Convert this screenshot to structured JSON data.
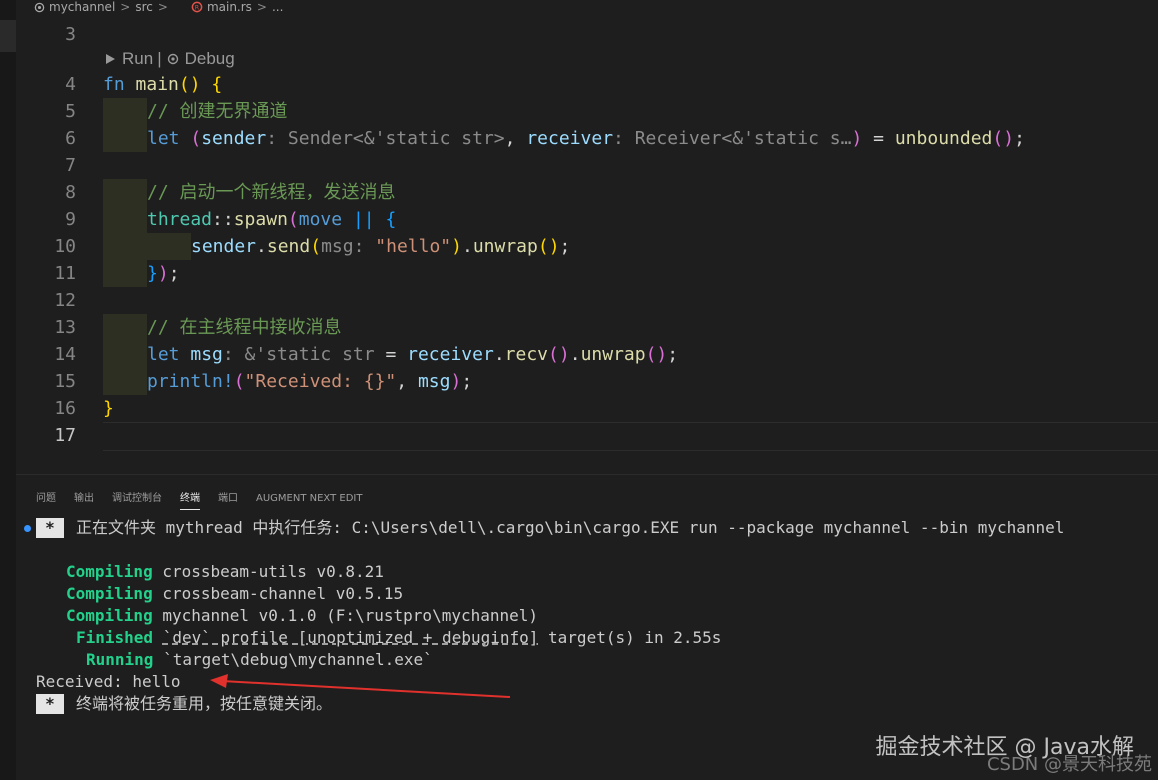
{
  "breadcrumb": {
    "items": [
      "mychannel",
      "src",
      "main.rs",
      "..."
    ],
    "separator": ">"
  },
  "codelens": {
    "run_icon": "play-icon",
    "run": "Run",
    "separator": "|",
    "debug_icon": "gear-icon",
    "debug": "Debug"
  },
  "line_numbers": [
    "3",
    "4",
    "5",
    "6",
    "7",
    "8",
    "9",
    "10",
    "11",
    "12",
    "13",
    "14",
    "15",
    "16",
    "17"
  ],
  "code": {
    "l4": {
      "kw": "fn",
      "name": "main",
      "parens": "()",
      "brace": "{"
    },
    "l5": "// 创建无界通道",
    "l6": {
      "let": "let",
      "open": "(",
      "sender": "sender",
      "sender_type": ": Sender<&'static str>",
      "comma": ",",
      "receiver": "receiver",
      "receiver_type": ": Receiver<&'static s…",
      "close": ")",
      "eq": "=",
      "call": "unbounded",
      "call_parens": "()",
      "semi": ";"
    },
    "l8": "// 启动一个新线程，发送消息",
    "l9": {
      "module": "thread",
      "sep": "::",
      "fn": "spawn",
      "open": "(",
      "move": "move",
      "pipes": "||",
      "brace": "{"
    },
    "l10": {
      "var": "sender",
      "dot": ".",
      "fn": "send",
      "open": "(",
      "hint": "msg:",
      "str": "\"hello\"",
      "close": ")",
      "dot2": ".",
      "fn2": "unwrap",
      "parens": "()",
      "semi": ";"
    },
    "l11": {
      "brace": "}",
      "paren": ")",
      "semi": ";"
    },
    "l13": "// 在主线程中接收消息",
    "l14": {
      "let": "let",
      "var": "msg",
      "type": ": &'static str",
      "eq": "=",
      "recv_var": "receiver",
      "dot": ".",
      "fn": "recv",
      "parens": "()",
      "dot2": ".",
      "fn2": "unwrap",
      "parens2": "()",
      "semi": ";"
    },
    "l15": {
      "mac": "println!",
      "open": "(",
      "str": "\"Received: {}\"",
      "comma": ",",
      "var": "msg",
      "close": ")",
      "semi": ";"
    },
    "l16": "}"
  },
  "panel": {
    "tabs": [
      "问题",
      "输出",
      "调试控制台",
      "终端",
      "端口",
      "AUGMENT NEXT EDIT"
    ],
    "active_tab": "终端"
  },
  "terminal": {
    "task_star": "*",
    "task_line": "正在文件夹 mythread 中执行任务: C:\\Users\\dell\\.cargo\\bin\\cargo.EXE run --package mychannel --bin mychannel",
    "compile": [
      {
        "status": "Compiling",
        "text": "crossbeam-utils v0.8.21"
      },
      {
        "status": "Compiling",
        "text": "crossbeam-channel v0.5.15"
      },
      {
        "status": "Compiling",
        "text": "mychannel v0.1.0 (F:\\rustpro\\mychannel)"
      }
    ],
    "finished_status": "Finished",
    "finished_profile": "`dev` profile [unoptimized + debuginfo]",
    "finished_rest": "target(s) in 2.55s",
    "running_status": "Running",
    "running_text": "`target\\debug\\mychannel.exe`",
    "output": "Received: hello",
    "reuse_star": "*",
    "reuse_text": "终端将被任务重用，按任意键关闭。"
  },
  "watermark": {
    "primary": "掘金技术社区 @ Java水解",
    "secondary": "CSDN @景天科技苑"
  },
  "colors": {
    "background": "#1e1e1e",
    "keyword": "#569cd6",
    "function": "#dcdcaa",
    "variable": "#9cdcfe",
    "comment": "#6a9955",
    "string": "#ce9178",
    "terminal_green": "#23d18b",
    "arrow_red": "#e0312c"
  }
}
